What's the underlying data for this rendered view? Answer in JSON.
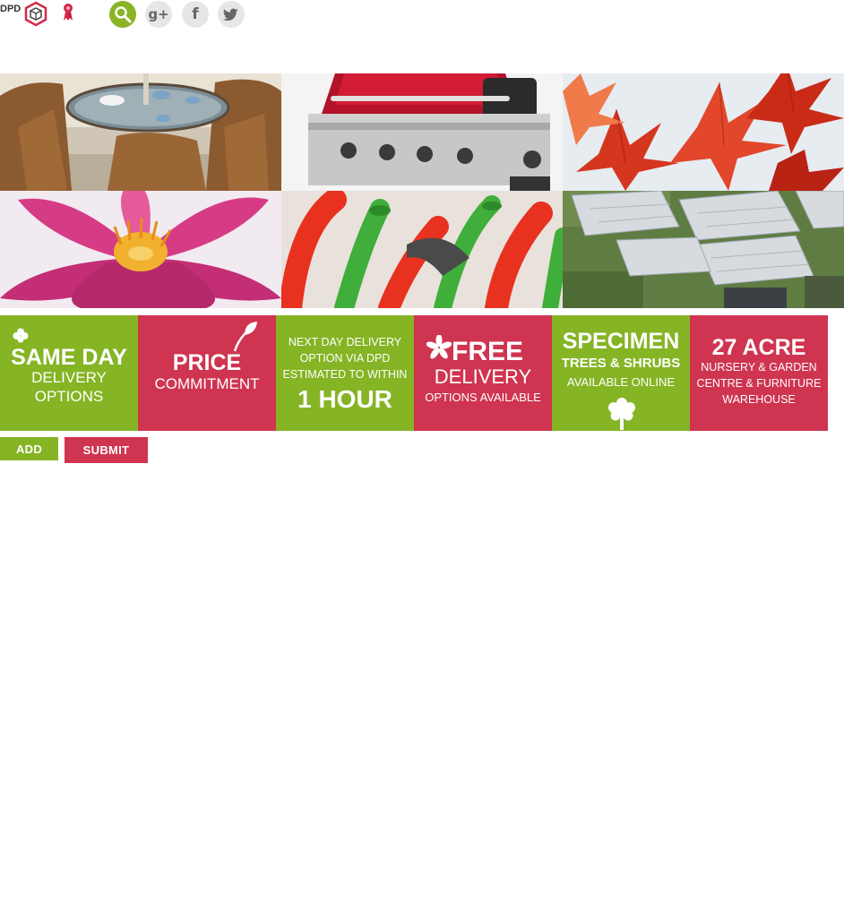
{
  "header": {
    "dpd_text": "DPD",
    "icons": [
      "dpd-cube-icon",
      "ribbon-icon",
      "search-icon",
      "google-plus-icon",
      "facebook-icon",
      "twitter-icon"
    ],
    "gplus_glyph": "g+",
    "facebook_glyph": "f",
    "twitter_glyph": "🐦"
  },
  "gallery": {
    "tiles": [
      "garden furniture",
      "barbecue",
      "acer leaves",
      "water lily",
      "watering cans",
      "nursery aerial view"
    ]
  },
  "promos": {
    "same_day": {
      "line1": "SAME DAY",
      "line2": "DELIVERY",
      "line3": "OPTIONS"
    },
    "price": {
      "line1": "PRICE",
      "line2": "COMMITMENT"
    },
    "next_day": {
      "line1": "NEXT DAY DELIVERY",
      "line2": "OPTION VIA DPD",
      "line3": "ESTIMATED TO WITHIN",
      "line4": "1 HOUR"
    },
    "free": {
      "line1": "FREE",
      "line2": "DELIVERY",
      "line3": "OPTIONS AVAILABLE"
    },
    "specimen": {
      "line1": "SPECIMEN",
      "line2": "TREES & SHRUBS",
      "line3": "AVAILABLE ONLINE"
    },
    "acre": {
      "line1": "27 ACRE",
      "line2": "NURSERY & GARDEN",
      "line3": "CENTRE & FURNITURE",
      "line4": "WAREHOUSE"
    }
  },
  "buttons": {
    "add": "ADD",
    "submit": "SUBMIT"
  },
  "colors": {
    "green": "#85b424",
    "red": "#cf3450"
  }
}
